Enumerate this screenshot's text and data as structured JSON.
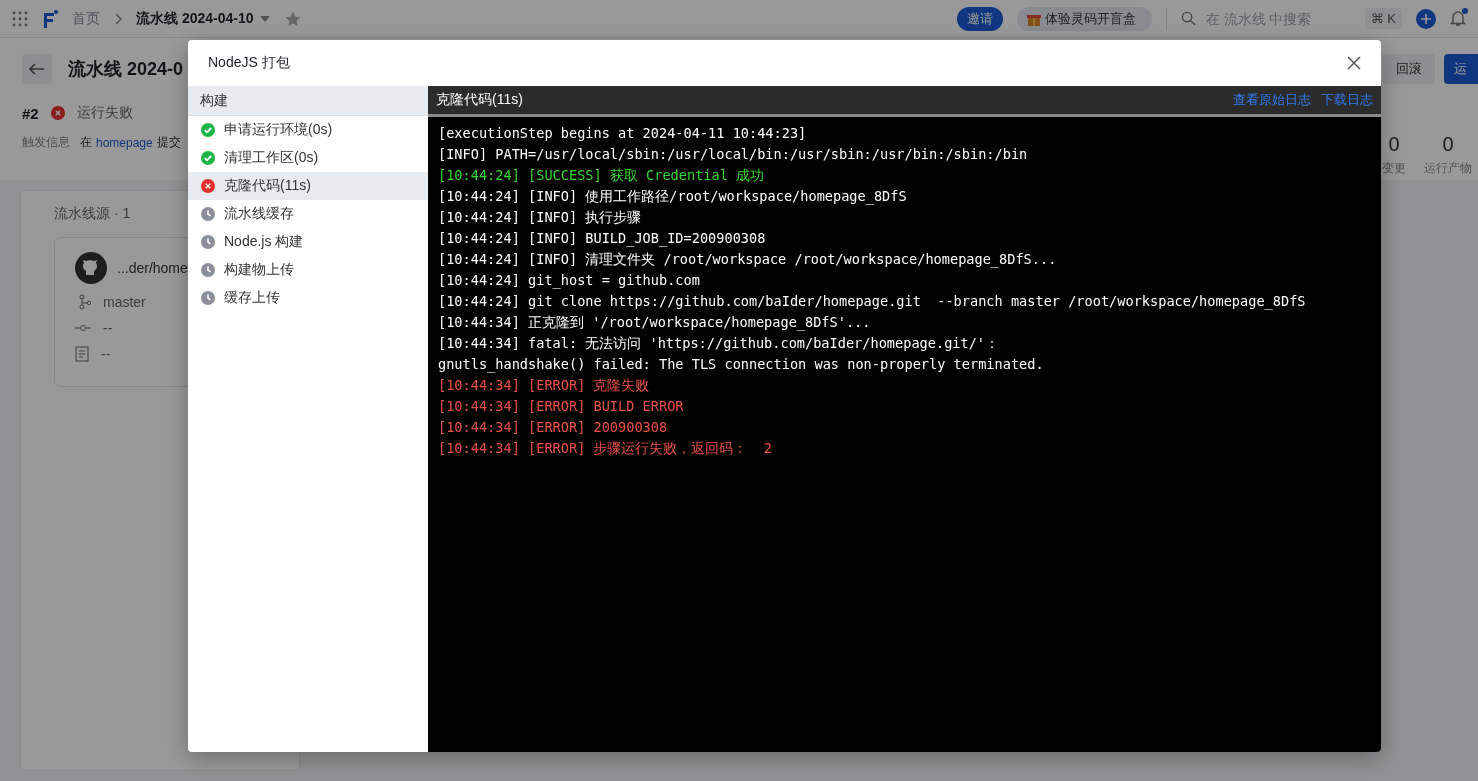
{
  "topbar": {
    "breadcrumb": [
      "首页",
      "流水线 2024-04-10"
    ],
    "invite": "邀请",
    "promo": "体验灵码开盲盒",
    "search": {
      "placeholder": "在 流水线 中搜索"
    },
    "shortcut": "⌘ K",
    "notification_dot": true
  },
  "header": {
    "title": "流水线 2024-0",
    "buttons": [
      "回滚",
      "运"
    ]
  },
  "run": {
    "number": "#2",
    "kind": "failed",
    "status_text": "运行失败",
    "trigger_label": "触发信息",
    "trigger_prefix": "在",
    "trigger_link": "homepage",
    "trigger_suffix": "提交"
  },
  "stats": [
    {
      "value": "0",
      "label": "变更"
    },
    {
      "value": "0",
      "label": "运行产物"
    }
  ],
  "source": {
    "title": "流水线源 · 1",
    "repo": "...der/home",
    "branch": "master",
    "commit": "--",
    "message": "--"
  },
  "dialog": {
    "title": "NodeJS 打包",
    "group": "构建",
    "steps": [
      {
        "label": "申请运行环境(0s)",
        "kind": "success",
        "selected": false
      },
      {
        "label": "清理工作区(0s)",
        "kind": "success",
        "selected": false
      },
      {
        "label": "克隆代码(11s)",
        "kind": "failed",
        "selected": true
      },
      {
        "label": "流水线缓存",
        "kind": "pending",
        "selected": false
      },
      {
        "label": "Node.js 构建",
        "kind": "pending",
        "selected": false
      },
      {
        "label": "构建物上传",
        "kind": "pending",
        "selected": false
      },
      {
        "label": "缓存上传",
        "kind": "pending",
        "selected": false
      }
    ],
    "log_title": "克隆代码(11s)",
    "links": [
      "查看原始日志",
      "下载日志"
    ],
    "log": [
      {
        "text": "[executionStep begins at 2024-04-11 10:44:23]",
        "kind": "info"
      },
      {
        "text": "[INFO] PATH=/usr/local/sbin:/usr/local/bin:/usr/sbin:/usr/bin:/sbin:/bin",
        "kind": "info"
      },
      {
        "text": "[10:44:24] [SUCCESS] 获取 Credential 成功",
        "kind": "success"
      },
      {
        "text": "[10:44:24] [INFO] 使用工作路径/root/workspace/homepage_8DfS",
        "kind": "info"
      },
      {
        "text": "[10:44:24] [INFO] 执行步骤",
        "kind": "info"
      },
      {
        "text": "[10:44:24] [INFO] BUILD_JOB_ID=200900308",
        "kind": "info"
      },
      {
        "text": "[10:44:24] [INFO] 清理文件夹 /root/workspace /root/workspace/homepage_8DfS...",
        "kind": "info"
      },
      {
        "text": "[10:44:24] git_host = github.com",
        "kind": "info"
      },
      {
        "text": "[10:44:24] git clone https://github.com/baIder/homepage.git  --branch master /root/workspace/homepage_8DfS",
        "kind": "info"
      },
      {
        "text": "[10:44:34] 正克隆到 '/root/workspace/homepage_8DfS'...",
        "kind": "info"
      },
      {
        "text": "[10:44:34] fatal: 无法访问 'https://github.com/baIder/homepage.git/'：",
        "kind": "info"
      },
      {
        "text": "gnutls_handshake() failed: The TLS connection was non-properly terminated.",
        "kind": "info"
      },
      {
        "text": "[10:44:34] [ERROR] 克隆失败",
        "kind": "error"
      },
      {
        "text": "[10:44:34] [ERROR] BUILD ERROR",
        "kind": "error"
      },
      {
        "text": "[10:44:34] [ERROR] 200900308",
        "kind": "error"
      },
      {
        "text": "[10:44:34] [ERROR] 步骤运行失败，返回码：  2",
        "kind": "error"
      }
    ]
  }
}
